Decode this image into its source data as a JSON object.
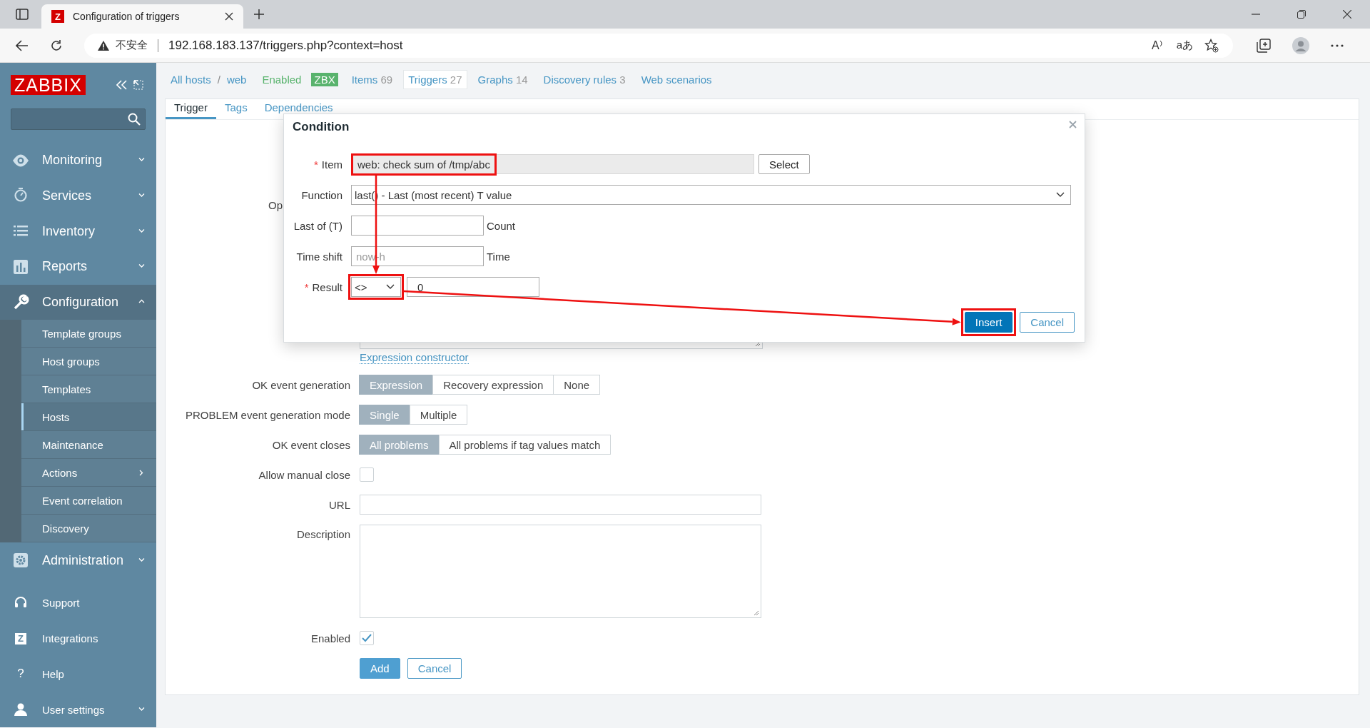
{
  "browser": {
    "favicon_text": "Z",
    "tab_title": "Configuration of triggers",
    "security_label": "不安全",
    "url": "192.168.183.137/triggers.php?context=host",
    "read_aloud_label": "A",
    "translate_label": "aあ"
  },
  "sidebar": {
    "logo": "ZABBIX",
    "menu": [
      {
        "label": "Monitoring",
        "kind": "eye",
        "expanded": false,
        "selected": false
      },
      {
        "label": "Services",
        "kind": "stopwatch",
        "expanded": false,
        "selected": false
      },
      {
        "label": "Inventory",
        "kind": "list",
        "expanded": false,
        "selected": false
      },
      {
        "label": "Reports",
        "kind": "chart",
        "expanded": false,
        "selected": false
      },
      {
        "label": "Configuration",
        "kind": "wrench",
        "expanded": true,
        "selected": true,
        "children": [
          {
            "label": "Template groups",
            "selected": false
          },
          {
            "label": "Host groups",
            "selected": false
          },
          {
            "label": "Templates",
            "selected": false
          },
          {
            "label": "Hosts",
            "selected": true
          },
          {
            "label": "Maintenance",
            "selected": false
          },
          {
            "label": "Actions",
            "selected": false,
            "has_submenu": true
          },
          {
            "label": "Event correlation",
            "selected": false
          },
          {
            "label": "Discovery",
            "selected": false
          }
        ]
      },
      {
        "label": "Administration",
        "kind": "gear",
        "expanded": false,
        "selected": false
      }
    ],
    "bottom_menu": [
      {
        "label": "Support",
        "kind": "headset"
      },
      {
        "label": "Integrations",
        "kind": "letter",
        "icon_text": "Z"
      },
      {
        "label": "Help",
        "kind": "letter",
        "icon_text": "?"
      },
      {
        "label": "User settings",
        "kind": "user",
        "expanded": false
      }
    ]
  },
  "header": {
    "breadcrumb": [
      "All hosts",
      "web"
    ],
    "separator": "/",
    "status": "Enabled",
    "badge": "ZBX",
    "links": [
      {
        "label": "Items",
        "count": "69",
        "selected": false
      },
      {
        "label": "Triggers",
        "count": "27",
        "selected": true
      },
      {
        "label": "Graphs",
        "count": "14",
        "selected": false
      },
      {
        "label": "Discovery rules",
        "count": "3",
        "selected": false
      },
      {
        "label": "Web scenarios",
        "selected": false
      }
    ]
  },
  "form": {
    "tabs": [
      {
        "label": "Trigger",
        "selected": true
      },
      {
        "label": "Tags",
        "selected": false
      },
      {
        "label": "Dependencies",
        "selected": false
      }
    ],
    "partial_label": "Op",
    "expression_link": "Expression constructor",
    "rows": [
      {
        "kind": "segmented",
        "label": "OK event generation",
        "options": [
          {
            "label": "Expression",
            "selected": true
          },
          {
            "label": "Recovery expression",
            "selected": false
          },
          {
            "label": "None",
            "selected": false
          }
        ]
      },
      {
        "kind": "segmented",
        "label": "PROBLEM event generation mode",
        "options": [
          {
            "label": "Single",
            "selected": true
          },
          {
            "label": "Multiple",
            "selected": false
          }
        ]
      },
      {
        "kind": "segmented",
        "label": "OK event closes",
        "options": [
          {
            "label": "All problems",
            "selected": true
          },
          {
            "label": "All problems if tag values match",
            "selected": false
          }
        ]
      },
      {
        "kind": "checkbox",
        "label": "Allow manual close",
        "checked": false
      },
      {
        "kind": "text",
        "label": "URL"
      },
      {
        "kind": "textarea",
        "label": "Description"
      },
      {
        "kind": "checkbox",
        "label": "Enabled",
        "checked": true
      }
    ],
    "buttons": [
      {
        "label": "Add",
        "primary": true
      },
      {
        "label": "Cancel",
        "primary": false
      }
    ]
  },
  "dialog": {
    "title": "Condition",
    "item": {
      "label": "Item",
      "required_mark": "*",
      "value": "web: check sum of /tmp/abc",
      "highlighted": true
    },
    "select_button": "Select",
    "function": {
      "label": "Function",
      "value": "last() - Last (most recent) T value"
    },
    "last_of": {
      "label": "Last of (T)",
      "suffix": "Count"
    },
    "time_shift": {
      "label": "Time shift",
      "placeholder": "now-h",
      "suffix": "Time"
    },
    "result": {
      "label": "Result",
      "required_mark": "*",
      "operator": "<>",
      "operator_highlighted": true,
      "value": "0"
    },
    "buttons": [
      {
        "label": "Insert",
        "primary": true,
        "highlighted": true
      },
      {
        "label": "Cancel",
        "primary": false
      }
    ],
    "annotation_arrows": true
  }
}
